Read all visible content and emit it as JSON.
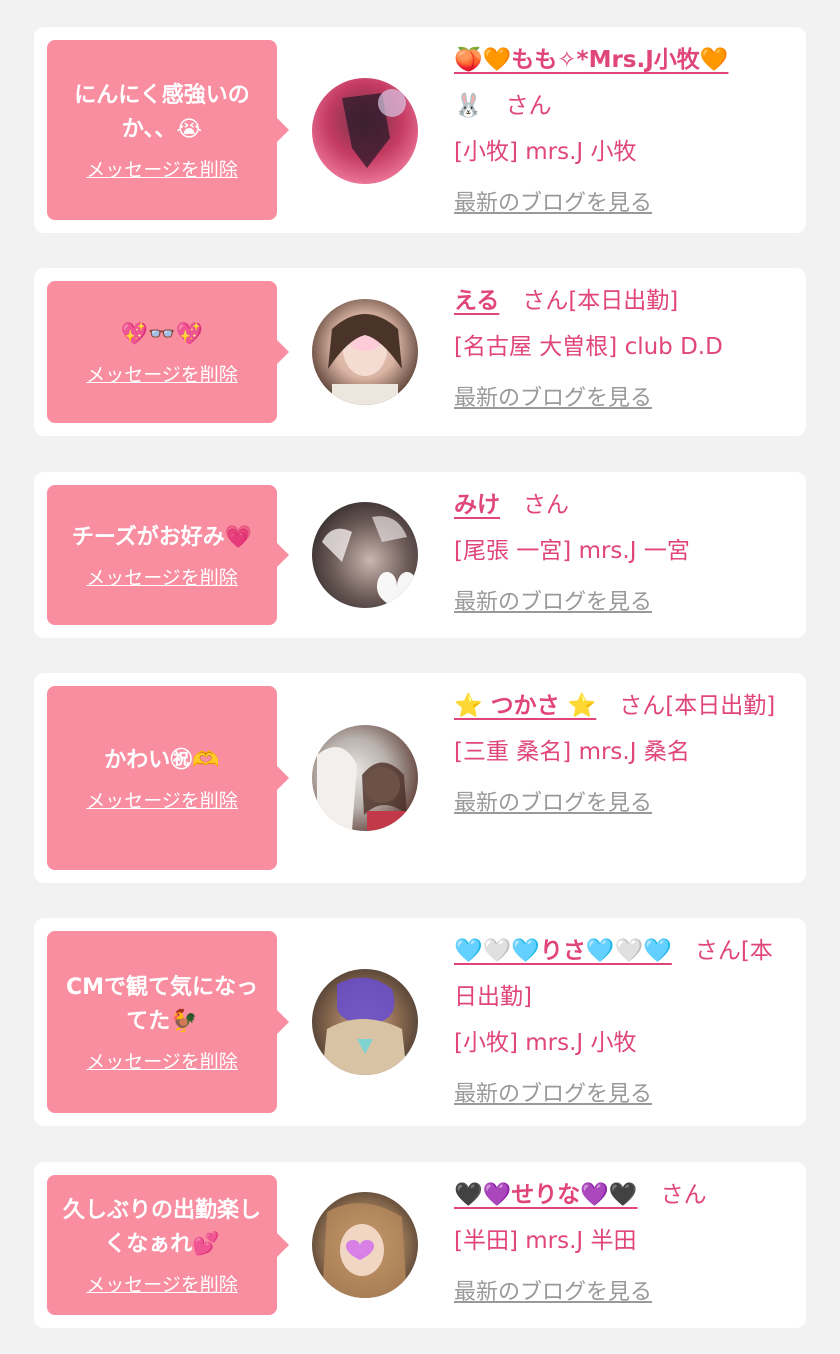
{
  "items": [
    {
      "message": "にんにく感強いのか、、😭",
      "delete_label": "メッセージを削除",
      "name": "🍑🧡もも✧*Mrs.J小牧🧡",
      "name_suffix": "🐰　さん",
      "shop": "[小牧] mrs.J 小牧",
      "blog_label": "最新のブログを見る"
    },
    {
      "message": "💖👓💖",
      "delete_label": "メッセージを削除",
      "name": "える",
      "name_suffix": "　さん[本日出勤]",
      "shop": "[名古屋 大曽根] club D.D",
      "blog_label": "最新のブログを見る"
    },
    {
      "message": "チーズがお好み💗",
      "delete_label": "メッセージを削除",
      "name": "みけ",
      "name_suffix": "　さん",
      "shop": "[尾張 一宮] mrs.J 一宮",
      "blog_label": "最新のブログを見る"
    },
    {
      "message": "かわい㊗🫶",
      "delete_label": "メッセージを削除",
      "name": "⭐ つかさ ⭐",
      "name_suffix": "　さん[本日出勤]",
      "shop": "[三重 桑名] mrs.J 桑名",
      "blog_label": "最新のブログを見る"
    },
    {
      "message": "CMで観て気になってた🐓",
      "delete_label": "メッセージを削除",
      "name": "🩵🤍🩵りさ🩵🤍🩵",
      "name_suffix": "　さん[本日出勤]",
      "shop": "[小牧] mrs.J 小牧",
      "blog_label": "最新のブログを見る"
    },
    {
      "message": "久しぶりの出勤楽しくなぁれ💕",
      "delete_label": "メッセージを削除",
      "name": "🖤💜せりな💜🖤",
      "name_suffix": "　さん",
      "shop": "[半田] mrs.J 半田",
      "blog_label": "最新のブログを見る"
    }
  ],
  "colors": {
    "bubble": "#f98ea1",
    "accent": "#e0457b",
    "link_gray": "#999999",
    "page_bg": "#f2f2f2"
  }
}
